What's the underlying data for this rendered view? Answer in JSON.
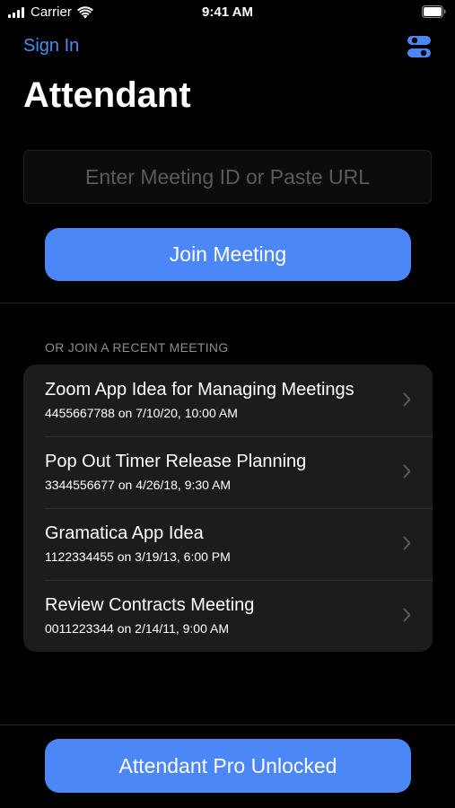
{
  "status_bar": {
    "carrier": "Carrier",
    "time": "9:41 AM",
    "icons": [
      "cellular-signal-icon",
      "wifi-icon",
      "battery-icon"
    ]
  },
  "nav": {
    "sign_in_label": "Sign In",
    "settings_icon": "toggle-switches-icon"
  },
  "title": "Attendant",
  "meeting_input": {
    "placeholder": "Enter Meeting ID or Paste URL",
    "value": ""
  },
  "join_button_label": "Join Meeting",
  "recent": {
    "header": "OR JOIN A RECENT MEETING",
    "items": [
      {
        "title": "Zoom App Idea for Managing Meetings",
        "subtitle": "4455667788 on 7/10/20, 10:00 AM"
      },
      {
        "title": "Pop Out Timer Release Planning",
        "subtitle": "3344556677 on 4/26/18, 9:30 AM"
      },
      {
        "title": "Gramatica App Idea",
        "subtitle": "1122334455 on 3/19/13, 6:00 PM"
      },
      {
        "title": "Review Contracts Meeting",
        "subtitle": "0011223344 on 2/14/11, 9:00 AM"
      }
    ]
  },
  "pro_button_label": "Attendant Pro Unlocked",
  "colors": {
    "accent": "#4b87f6",
    "link": "#4a8ff0",
    "background": "#000000",
    "card": "#1c1c1e",
    "secondary_text": "#8d8d92"
  }
}
